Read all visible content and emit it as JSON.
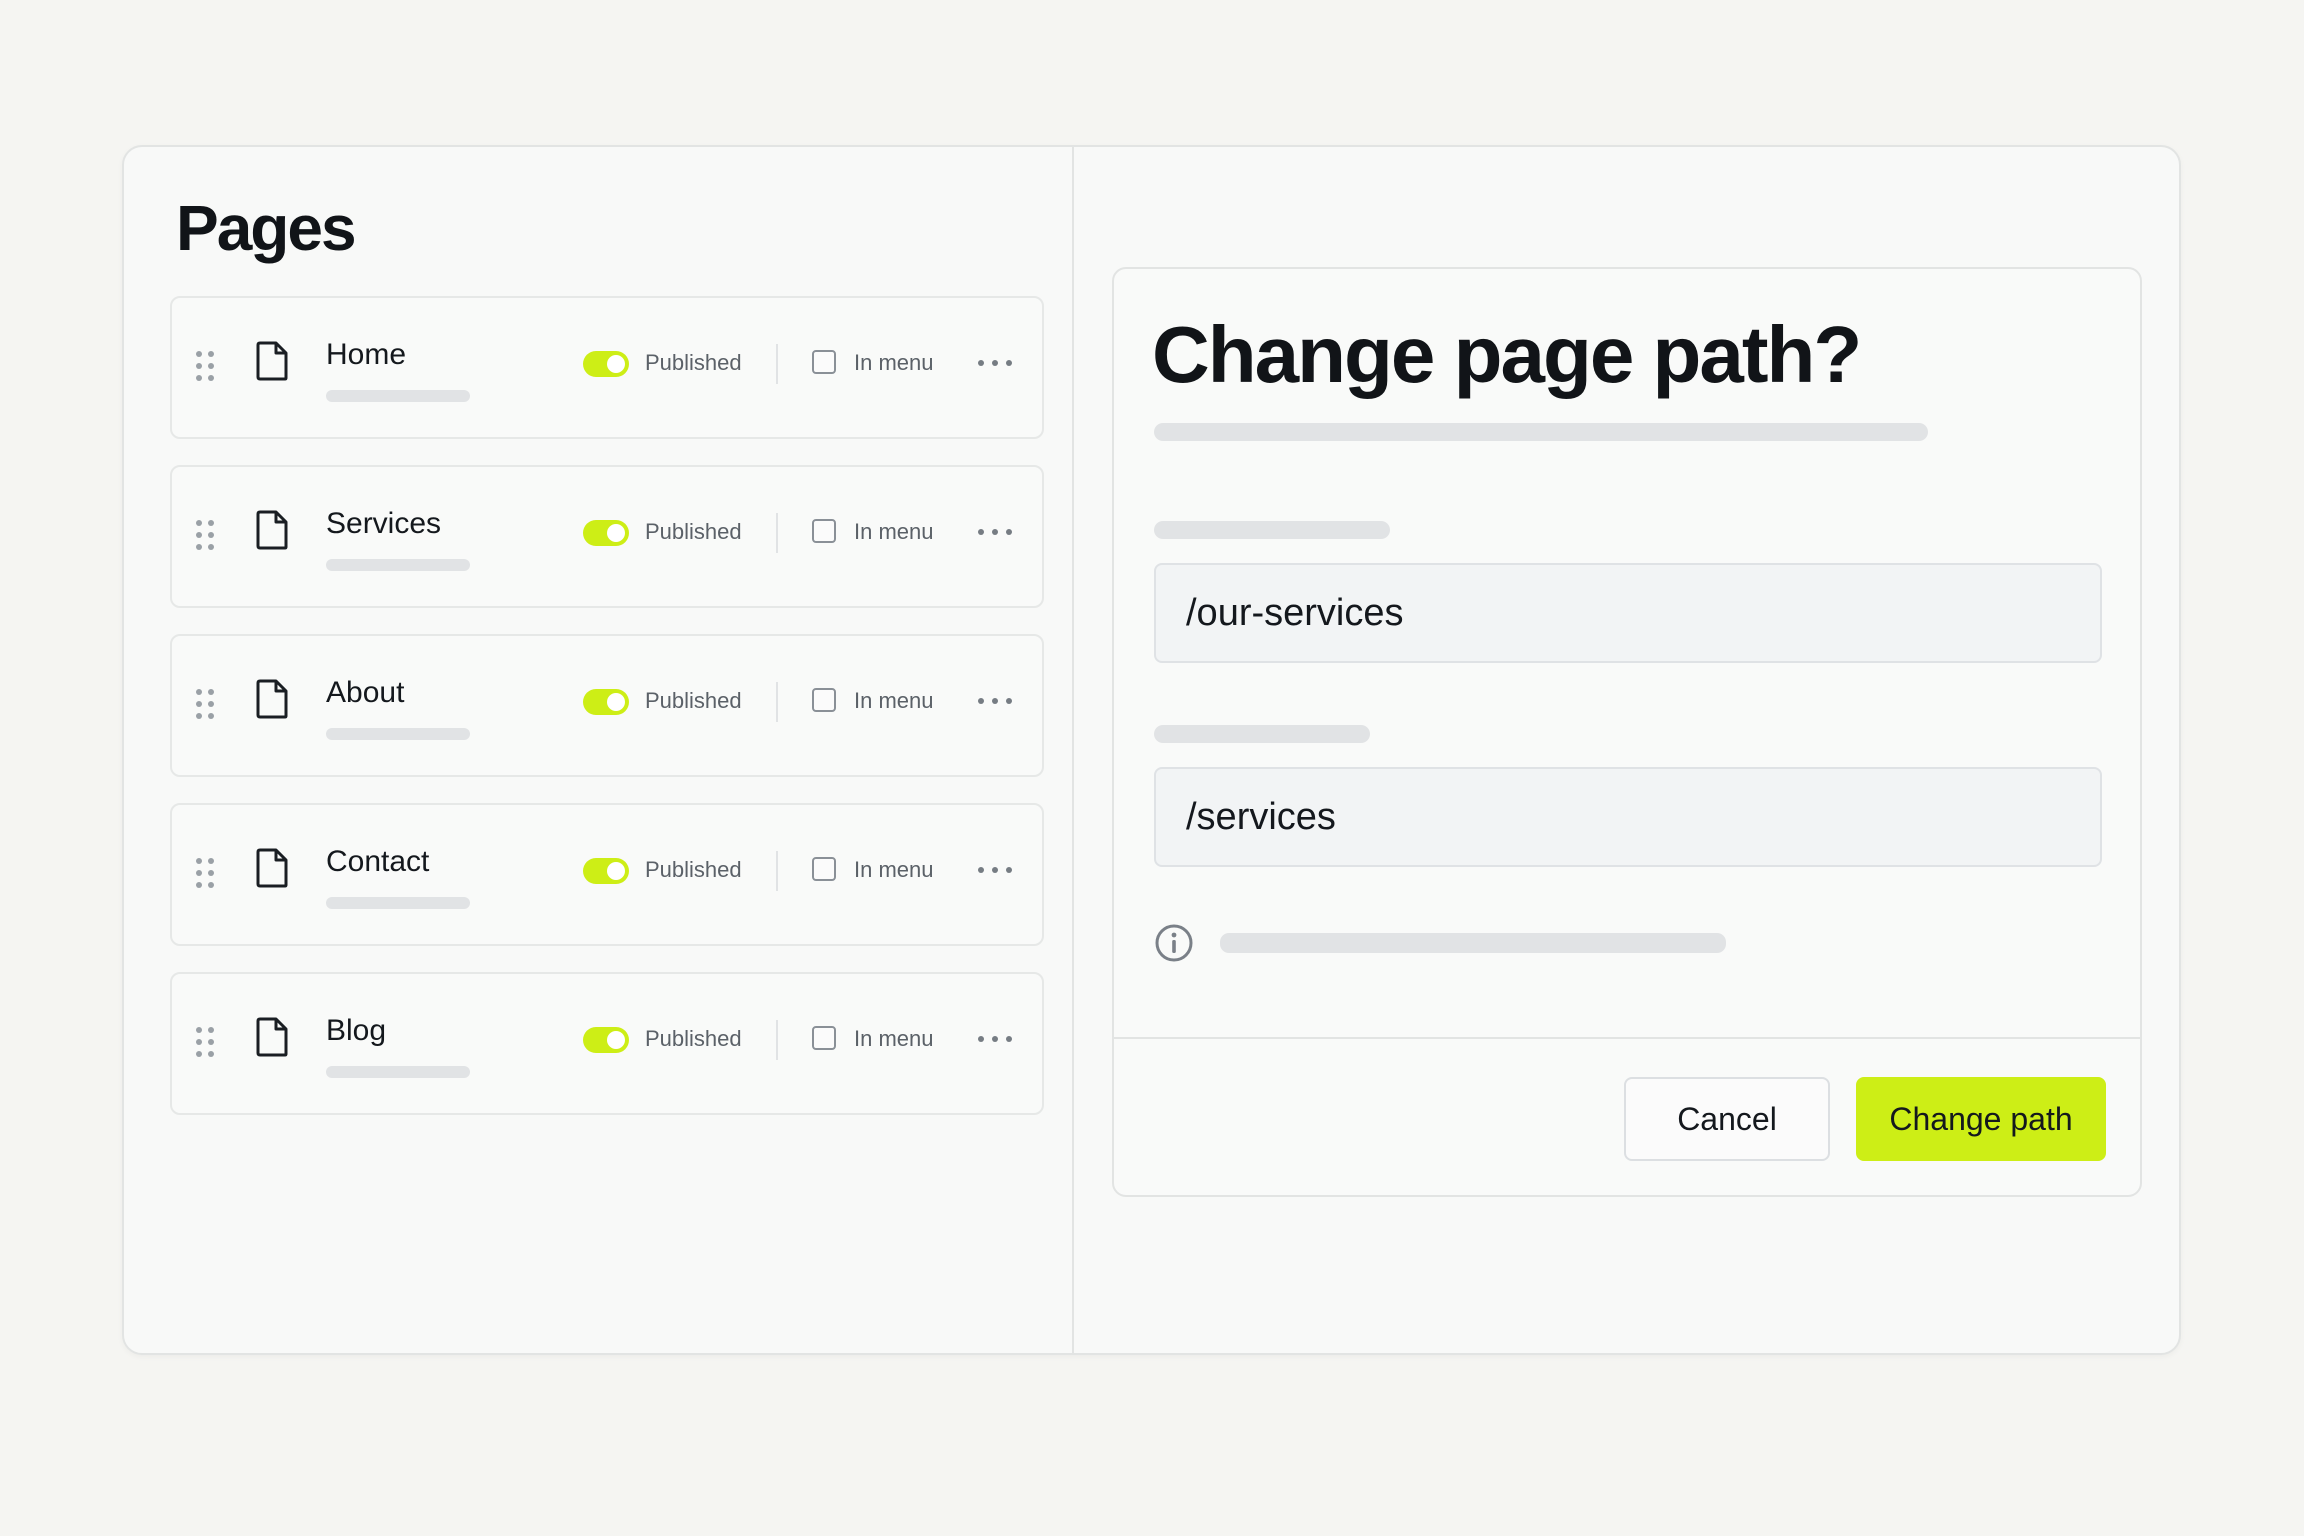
{
  "pages_panel": {
    "title": "Pages",
    "items": [
      {
        "name": "Home",
        "status": "Published",
        "menu_label": "In menu"
      },
      {
        "name": "Services",
        "status": "Published",
        "menu_label": "In menu"
      },
      {
        "name": "About",
        "status": "Published",
        "menu_label": "In menu"
      },
      {
        "name": "Contact",
        "status": "Published",
        "menu_label": "In menu"
      },
      {
        "name": "Blog",
        "status": "Published",
        "menu_label": "In menu"
      }
    ]
  },
  "dialog": {
    "title": "Change page path?",
    "old_path": "/our-services",
    "new_path": "/services",
    "cancel_label": "Cancel",
    "confirm_label": "Change path"
  },
  "colors": {
    "accent": "#cdee16",
    "background": "#f5f5f2",
    "text": "#111418"
  },
  "icons": [
    "drag-handle-icon",
    "document-icon",
    "more-icon",
    "info-icon"
  ]
}
